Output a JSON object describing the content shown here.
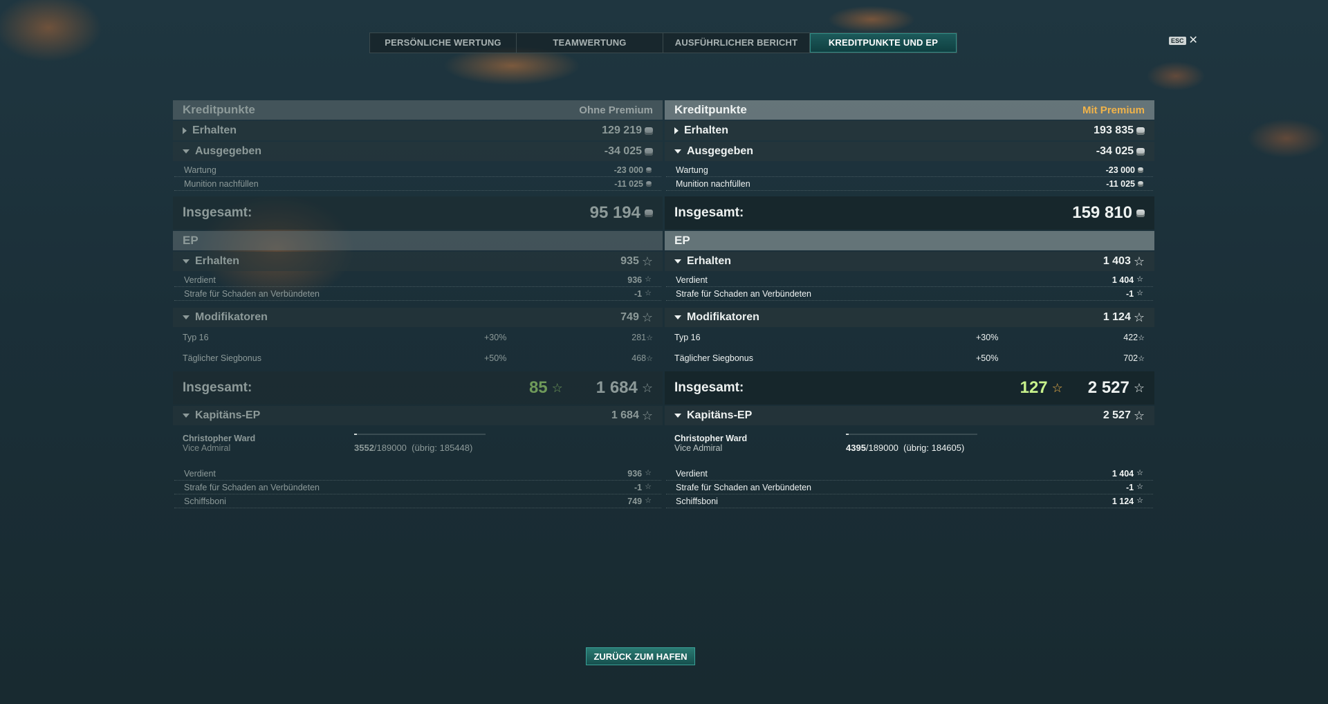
{
  "tabs": [
    {
      "label": "PERSÖNLICHE WERTUNG"
    },
    {
      "label": "TEAMWERTUNG"
    },
    {
      "label": "AUSFÜHRLICHER BERICHT"
    },
    {
      "label": "KREDITPUNKTE UND EP"
    }
  ],
  "esc": {
    "key": "ESC",
    "close": "✕"
  },
  "left": {
    "credits_title": "Kreditpunkte",
    "premium_label": "Ohne Premium",
    "earned": {
      "label": "Erhalten",
      "value": "129 219"
    },
    "spent": {
      "label": "Ausgegeben",
      "value": "-34 025",
      "items": [
        {
          "label": "Wartung",
          "value": "-23 000"
        },
        {
          "label": "Munition nachfüllen",
          "value": "-11 025"
        }
      ]
    },
    "credits_total": {
      "label": "Insgesamt:",
      "value": "95 194"
    },
    "ep_title": "EP",
    "ep_earned": {
      "label": "Erhalten",
      "value": "935",
      "items": [
        {
          "label": "Verdient",
          "value": "936"
        },
        {
          "label": "Strafe für Schaden an Verbündeten",
          "value": "-1"
        }
      ]
    },
    "modifiers": {
      "label": "Modifikatoren",
      "value": "749",
      "items": [
        {
          "label": "Typ 16",
          "pct": "+30%",
          "value": "281"
        },
        {
          "label": "Täglicher Siegbonus",
          "pct": "+50%",
          "value": "468"
        }
      ]
    },
    "ep_total": {
      "label": "Insgesamt:",
      "free": "85",
      "value": "1 684"
    },
    "captain": {
      "label": "Kapitäns-EP",
      "value": "1 684",
      "name": "Christopher Ward",
      "rank": "Vice Admiral",
      "xp_current": "3552",
      "xp_max": "/189000",
      "xp_left": "(übrig: 185448)",
      "progress": 0.019,
      "items": [
        {
          "label": "Verdient",
          "value": "936"
        },
        {
          "label": "Strafe für Schaden an Verbündeten",
          "value": "-1"
        },
        {
          "label": "Schiffsboni",
          "value": "749"
        }
      ]
    }
  },
  "right": {
    "credits_title": "Kreditpunkte",
    "premium_label": "Mit Premium",
    "earned": {
      "label": "Erhalten",
      "value": "193 835"
    },
    "spent": {
      "label": "Ausgegeben",
      "value": "-34 025",
      "items": [
        {
          "label": "Wartung",
          "value": "-23 000"
        },
        {
          "label": "Munition nachfüllen",
          "value": "-11 025"
        }
      ]
    },
    "credits_total": {
      "label": "Insgesamt:",
      "value": "159 810"
    },
    "ep_title": "EP",
    "ep_earned": {
      "label": "Erhalten",
      "value": "1 403",
      "items": [
        {
          "label": "Verdient",
          "value": "1 404"
        },
        {
          "label": "Strafe für Schaden an Verbündeten",
          "value": "-1"
        }
      ]
    },
    "modifiers": {
      "label": "Modifikatoren",
      "value": "1 124",
      "items": [
        {
          "label": "Typ 16",
          "pct": "+30%",
          "value": "422"
        },
        {
          "label": "Täglicher Siegbonus",
          "pct": "+50%",
          "value": "702"
        }
      ]
    },
    "ep_total": {
      "label": "Insgesamt:",
      "free": "127",
      "value": "2 527"
    },
    "captain": {
      "label": "Kapitäns-EP",
      "value": "2 527",
      "name": "Christopher Ward",
      "rank": "Vice Admiral",
      "xp_current": "4395",
      "xp_max": "/189000",
      "xp_left": "(übrig: 184605)",
      "progress": 0.023,
      "items": [
        {
          "label": "Verdient",
          "value": "1 404"
        },
        {
          "label": "Strafe für Schaden an Verbündeten",
          "value": "-1"
        },
        {
          "label": "Schiffsboni",
          "value": "1 124"
        }
      ]
    }
  },
  "back_button": "ZURÜCK ZUM HAFEN"
}
